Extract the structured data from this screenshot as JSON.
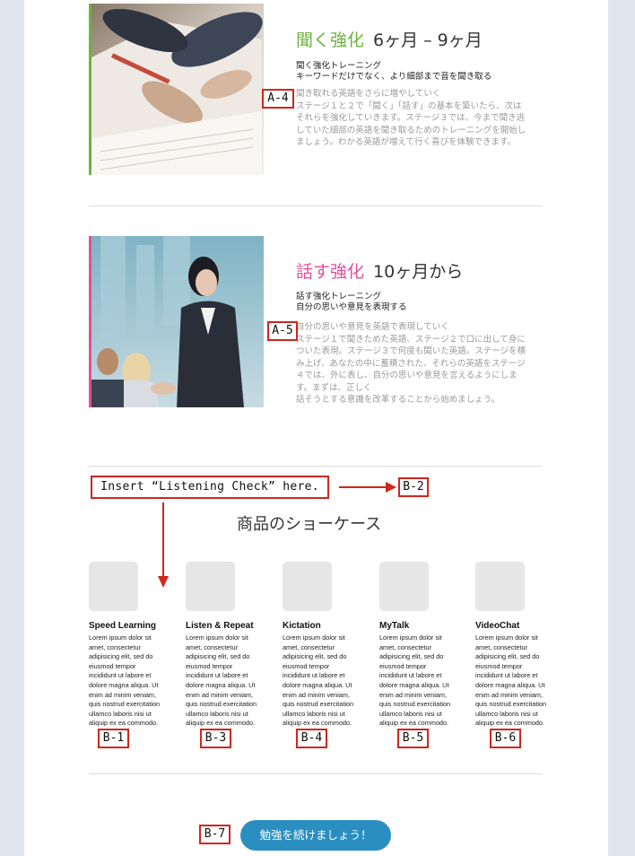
{
  "stages": [
    {
      "title": "聞く強化",
      "duration": "6ヶ月 – 9ヶ月",
      "color": "#6cb33e",
      "subtitle_line1": "聞く強化トレーニング",
      "subtitle_line2": "キーワードだけでなく、より細部まで音を聞き取る",
      "body": "聞き取れる英語をさらに増やしていく\nステージ１と２で「聞く」「話す」の基本を築いたら、次はそれらを強化していきます。ステージ３では、今まで聞き逃していた細部の英語を聞き取るためのトレーニングを開始しましょう。わかる英語が増えて行く喜びを体験できます。",
      "annotation": "A-4"
    },
    {
      "title": "話す強化",
      "duration": "10ヶ月から",
      "color": "#e0509a",
      "subtitle_line1": "話す強化トレーニング",
      "subtitle_line2": "自分の思いや意見を表現する",
      "body": "自分の思いや意見を英語で表現していく\nステージ１で聞きためた英語、ステージ２で口に出して身についた表現。ステージ３で何度も聞いた英語。ステージを積み上げ、あなたの中に蓄積された、それらの英語をステージ４では、外に表し、自分の思いや意見を言えるようにします。まずは、正しく\n話そうとする意識を改革することから始めましょう。",
      "annotation": "A-5"
    }
  ],
  "insert_note": "Insert “Listening Check” here.",
  "insert_note_target": "B-2",
  "showcase_title": "商品のショーケース",
  "products": [
    {
      "name": "Speed Learning",
      "desc": "Lorem ipsum dolor sit amet, consectetur adipisicing elit, sed do eiusmod tempor incididunt ut labore et dolore magna aliqua. Ut enim ad minim veniam, quis nostrud exercitation ullamco laboris nisi ut aliquip ex ea commodo.",
      "annotation": "B-1"
    },
    {
      "name": "Listen & Repeat",
      "desc": "Lorem ipsum dolor sit amet, consectetur adipisicing elit, sed do eiusmod tempor incididunt ut labore et dolore magna aliqua. Ut enim ad minim veniam, quis nostrud exercitation ullamco laboris nisi ut aliquip ex ea commodo.",
      "annotation": "B-3"
    },
    {
      "name": "Kictation",
      "desc": "Lorem ipsum dolor sit amet, consectetur adipisicing elit, sed do eiusmod tempor incididunt ut labore et dolore magna aliqua. Ut enim ad minim veniam, quis nostrud exercitation ullamco laboris nisi ut aliquip ex ea commodo.",
      "annotation": "B-4"
    },
    {
      "name": "MyTalk",
      "desc": "Lorem ipsum dolor sit amet, consectetur adipisicing elit, sed do eiusmod tempor incididunt ut labore et dolore magna aliqua. Ut enim ad minim veniam, quis nostrud exercitation ullamco laboris nisi ut aliquip ex ea commodo.",
      "annotation": "B-5"
    },
    {
      "name": "VideoChat",
      "desc": "Lorem ipsum dolor sit amet, consectetur adipisicing elit, sed do eiusmod tempor incididunt ut labore et dolore magna aliqua. Ut enim ad minim veniam, quis nostrud exercitation ullamco laboris nisi ut aliquip ex ea commodo.",
      "annotation": "B-6"
    }
  ],
  "cta_label": "勉強を続けましょう！",
  "cta_annotation": "B-7",
  "colors": {
    "annotation_red": "#d0261c",
    "cta_blue": "#2a8fc0",
    "page_bg": "#dfe5ee"
  }
}
